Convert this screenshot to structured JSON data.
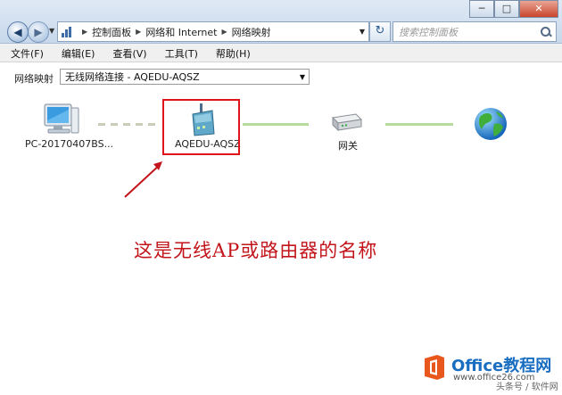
{
  "window": {
    "minimize_label": "─",
    "maximize_label": "□",
    "close_label": "✕"
  },
  "nav": {
    "back_glyph": "◀",
    "forward_glyph": "▶",
    "dropdown_glyph": "▼"
  },
  "breadcrumb": [
    "控制面板",
    "网络和 Internet",
    "网络映射"
  ],
  "breadcrumb_sep": "▶",
  "address_dropdown": "▼",
  "refresh_glyph": "↻",
  "search": {
    "placeholder": "搜索控制面板"
  },
  "menu": [
    "文件(F)",
    "编辑(E)",
    "查看(V)",
    "工具(T)",
    "帮助(H)"
  ],
  "toolbar": {
    "label": "网络映射",
    "selected": "无线网络连接 - AQEDU-AQSZ",
    "arrow": "▼"
  },
  "nodes": {
    "computer": {
      "label": "PC-20170407BS...",
      "icon": "computer-icon"
    },
    "router": {
      "label": "AQEDU-AQSZ",
      "icon": "wireless-router-icon"
    },
    "gateway": {
      "label": "网关",
      "icon": "gateway-icon"
    },
    "internet": {
      "label": "",
      "icon": "globe-icon"
    }
  },
  "annotation_text": "这是无线AP或路由器的名称",
  "watermark": {
    "title": "Office教程网",
    "url": "www.office26.com",
    "corner": "头条号 / 软件网"
  },
  "colors": {
    "highlight": "#e0151b",
    "annotation": "#c2141a",
    "link_solid": "#b8dba0",
    "link_dashed": "#c9cdb7",
    "watermark_orange": "#e8581c",
    "watermark_blue": "#1a6ec2"
  }
}
